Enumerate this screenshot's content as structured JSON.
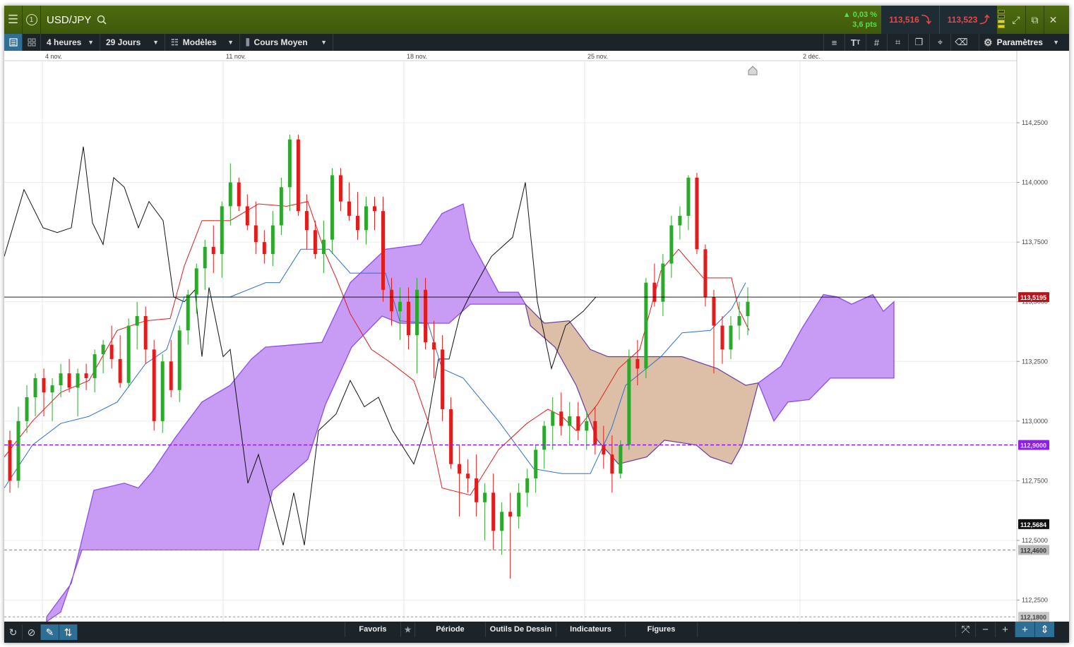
{
  "header": {
    "symbol": "USD/JPY",
    "change_pct": "▲ 0,03 %",
    "change_pts": "3,6 pts",
    "bid": "113,516",
    "ask": "113,523",
    "alert_count": "1"
  },
  "toolbar": {
    "interval": "4 heures",
    "range": "29 Jours",
    "templates": "Modèles",
    "price_type": "Cours Moyen",
    "settings": "Paramètres"
  },
  "bottom": {
    "tabs": [
      "Favoris",
      "Période",
      "Outils De Dessin",
      "Indicateurs",
      "Figures"
    ]
  },
  "chart_data": {
    "type": "candlestick",
    "x_tick_labels": [
      "4 nov.",
      "11 nov.",
      "18 nov.",
      "25 nov.",
      "2 déc."
    ],
    "y_tick_labels": [
      "114,2500",
      "114,0000",
      "113,7500",
      "113,5000",
      "113,2500",
      "113,0000",
      "112,7500",
      "112,5000",
      "112,2500"
    ],
    "ylim": [
      112.16,
      114.51
    ],
    "current_price_label": "113,5195",
    "current_price": 113.5195,
    "level_purple_label": "112,9000",
    "level_purple": 112.9,
    "level_low_label": "112,5684",
    "level_low": 112.5684,
    "level_gray_label": "112,4600",
    "level_gray": 112.46,
    "level_bottom_label": "112,1800",
    "level_bottom": 112.18,
    "colors": {
      "up": "#2ca82c",
      "down": "#e31b1b",
      "tenkan": "#e31b1b",
      "kijun": "#2d6fd1",
      "chikou": "#111111",
      "cloud_bull": "#c89bf4",
      "cloud_bear": "#dcbfa6",
      "price_tag": "#b5161a",
      "purple_tag": "#8e1fe6"
    }
  }
}
